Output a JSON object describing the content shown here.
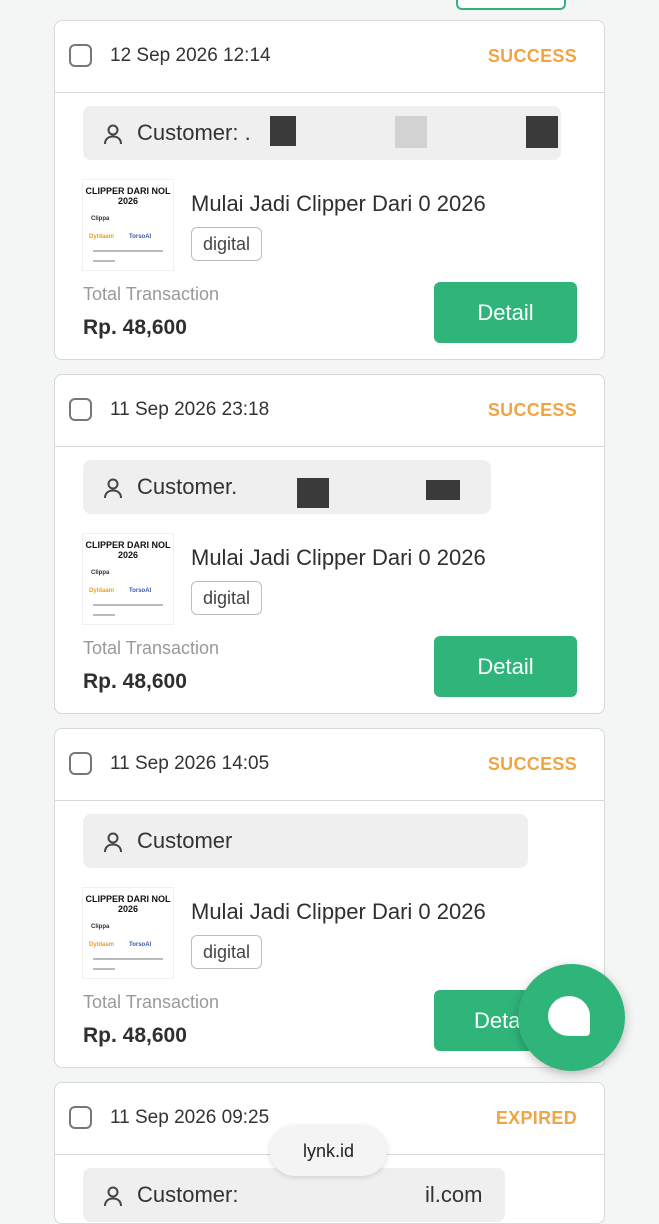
{
  "orders": [
    {
      "date": "12 Sep 2026 12:14",
      "status": "SUCCESS",
      "customer_label": "Customer: .",
      "product": "Mulai Jadi Clipper Dari 0 2026",
      "tag": "digital",
      "total_label": "Total Transaction",
      "total_value": "Rp. 48,600",
      "detail_label": "Detail"
    },
    {
      "date": "11 Sep 2026 23:18",
      "status": "SUCCESS",
      "customer_label": "Customer.",
      "product": "Mulai Jadi Clipper Dari 0 2026",
      "tag": "digital",
      "total_label": "Total Transaction",
      "total_value": "Rp. 48,600",
      "detail_label": "Detail"
    },
    {
      "date": "11 Sep 2026 14:05",
      "status": "SUCCESS",
      "customer_label": "Customer",
      "product": "Mulai Jadi Clipper Dari 0 2026",
      "tag": "digital",
      "total_label": "Total Transaction",
      "total_value": "Rp. 48,600",
      "detail_label": "Deta"
    },
    {
      "date": "11 Sep 2026 09:25",
      "status": "EXPIRED",
      "customer_label": "Customer:",
      "customer_suffix": "il.com"
    }
  ],
  "thumbnail_text": "CLIPPER DARI NOL 2026",
  "thumbnail_logos": [
    "Clippa",
    "Dyldaam",
    "TorsoAI"
  ],
  "colors": {
    "accent": "#2fb47a",
    "success": "#f0a545",
    "expired": "#f0a545"
  },
  "icons": {
    "customer": "person-icon",
    "chat": "chat-bubble-icon"
  },
  "watermark": "lynk.id"
}
